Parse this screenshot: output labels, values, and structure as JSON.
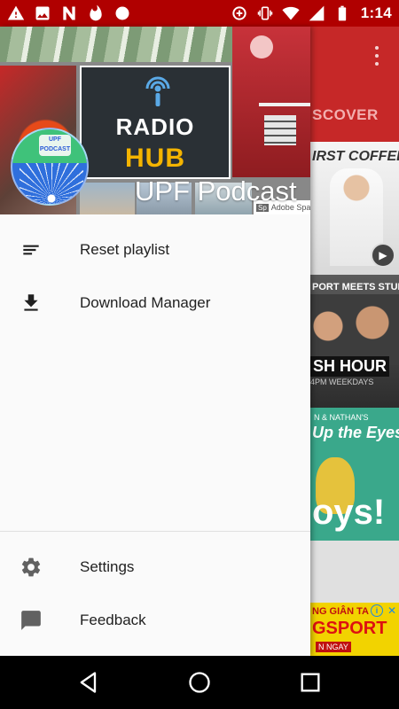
{
  "status_bar": {
    "time": "1:14",
    "left_icons": [
      "warning-icon",
      "image-icon",
      "n-app-icon",
      "fire-icon",
      "circle-icon"
    ],
    "right_icons": [
      "data-saver-icon",
      "vibrate-icon",
      "wifi-icon",
      "signal-icon",
      "battery-icon"
    ]
  },
  "drawer": {
    "header": {
      "title": "UPF Podcast",
      "collage": {
        "radio_line1": "RADIO",
        "radio_line2": "HUB",
        "spark_logo": "Sp",
        "spark_label": "Adobe Spark"
      },
      "avatar_text": "UPF PODCAST"
    },
    "items": [
      {
        "label": "Reset playlist",
        "icon": "playlist-icon"
      },
      {
        "label": "Download Manager",
        "icon": "download-icon"
      }
    ],
    "footer_items": [
      {
        "label": "Settings",
        "icon": "gear-icon"
      },
      {
        "label": "Feedback",
        "icon": "feedback-icon"
      }
    ]
  },
  "background": {
    "tab_label": "SCOVER",
    "card1_text": "IRST COFFEE",
    "card2_top": "PORT MEETS STUPID",
    "card2_big": "SH HOUR",
    "card2_small": "4PM WEEKDAYS",
    "card3_top": "N & NATHAN'S",
    "card3_mid": "Up the Eyes,",
    "card3_big": "oys!",
    "ad_line1": "NG GIÂN TA",
    "ad_line2": "GSPORT",
    "ad_line3": "N NGAY",
    "ad_info": "i",
    "ad_close": "✕"
  },
  "colors": {
    "status_bar": "#b00000",
    "drawer_bg": "#fafafa",
    "accent_red": "#c62828"
  }
}
